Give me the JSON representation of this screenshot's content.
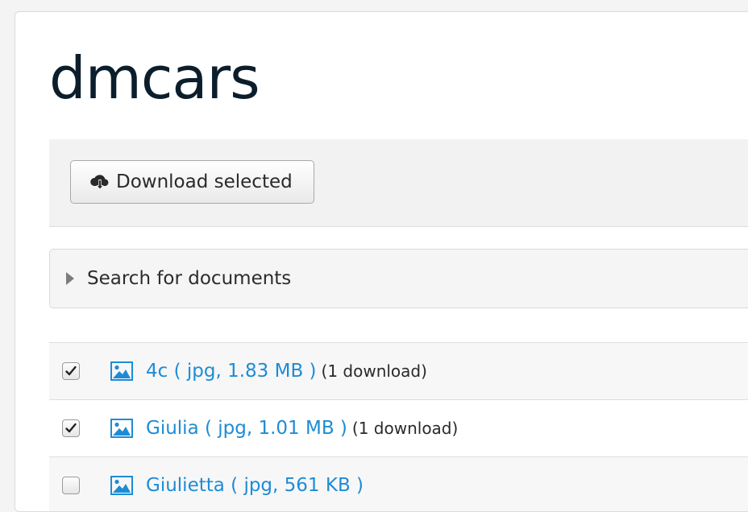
{
  "page": {
    "title": "dmcars"
  },
  "toolbar": {
    "download_label": "Download selected"
  },
  "search": {
    "label": "Search for documents"
  },
  "documents": [
    {
      "name": "4c",
      "link_text": "4c ( jpg, 1.83 MB )",
      "downloads": "(1 download)",
      "checked": true
    },
    {
      "name": "Giulia",
      "link_text": "Giulia ( jpg, 1.01 MB )",
      "downloads": "(1 download)",
      "checked": true
    },
    {
      "name": "Giulietta",
      "link_text": "Giulietta ( jpg, 561 KB )",
      "downloads": "",
      "checked": false
    }
  ],
  "colors": {
    "link": "#1d8cd6",
    "title": "#0c1e2c"
  },
  "icons": {
    "download": "cloud-download-icon",
    "search_toggle": "caret-right-icon",
    "document": "image-icon",
    "check": "checkmark-icon"
  }
}
